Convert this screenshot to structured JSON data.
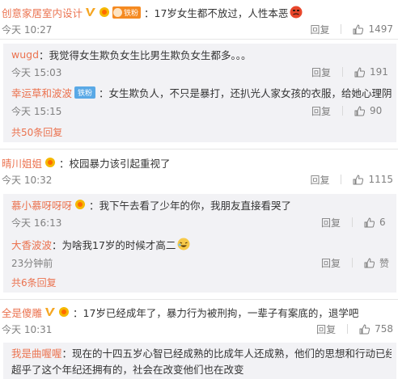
{
  "reply_label": "回复",
  "c1": {
    "user": "创意家居室内设计",
    "fan_badge": "铁粉",
    "text": "17岁女生都不放过，人性本恶",
    "time": "今天 10:27",
    "likes": "1497",
    "replies": [
      {
        "user": "wugd",
        "text": "我觉得女生欺负女生比男生欺负女生都多。。。",
        "time": "今天 15:03",
        "likes": "191"
      },
      {
        "user": "幸运草和波波",
        "badge": "铁粉",
        "text": "女生欺负人，不只是暴打，还扒光人家女孩的衣服，给她心理阴影",
        "time": "今天 15:15",
        "likes": "90"
      }
    ],
    "more": "共50条回复"
  },
  "c2": {
    "user": "晴川姐姐",
    "text": "校园暴力该引起重视了",
    "time": "今天 10:32",
    "likes": "1115",
    "replies": [
      {
        "user": "慕小慕呀呀呀",
        "text": "我下午去看了少年的你，我朋友直接看哭了",
        "time": "今天 16:13",
        "likes": "6"
      },
      {
        "user": "大香波波",
        "text": "为啥我17岁的时候才高二",
        "time": "23分钟前",
        "likes": "赞"
      }
    ],
    "more": "共6条回复"
  },
  "c3": {
    "user": "全是傻雕",
    "text": "17岁已经成年了，暴力行为被刑拘，一辈子有案底的，退学吧",
    "time": "今天 10:31",
    "likes": "758",
    "replies": [
      {
        "user": "我是曲喔喔",
        "text_line1": "现在的十四五岁心智已经成熟的比成年人还成熟，他们的思想和行动已经",
        "text_line2": "超乎了这个年纪还拥有的，社会在改变他们也在改变"
      }
    ]
  }
}
